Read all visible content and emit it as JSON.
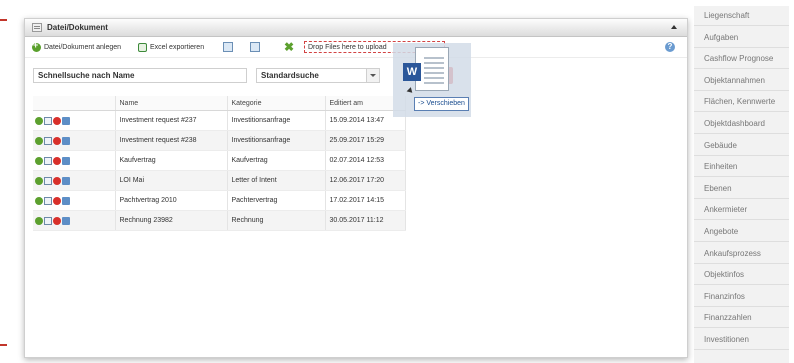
{
  "panel": {
    "title": "Datei/Dokument"
  },
  "toolbar": {
    "add_label": "Datei/Dokument anlegen",
    "export_label": "Excel exportieren",
    "dropzone_text": "Drop Files here to upload",
    "help_symbol": "?"
  },
  "search": {
    "quick_value": "Schnellsuche nach Name",
    "mode_value": "Standardsuche",
    "button_tail": "n"
  },
  "grid": {
    "columns": [
      "Name",
      "Kategorie",
      "Editiert am"
    ],
    "rows": [
      {
        "name": "Investment request #237",
        "kategorie": "Investitionsanfrage",
        "editiert": "15.09.2014 13:47"
      },
      {
        "name": "Investment request #238",
        "kategorie": "Investitionsanfrage",
        "editiert": "25.09.2017 15:29"
      },
      {
        "name": "Kaufvertrag",
        "kategorie": "Kaufvertrag",
        "editiert": "02.07.2014 12:53"
      },
      {
        "name": "LOI Mai",
        "kategorie": "Letter of Intent",
        "editiert": "12.06.2017 17:20"
      },
      {
        "name": "Pachtvertrag 2010",
        "kategorie": "Pachtervertrag",
        "editiert": "17.02.2017 14:15"
      },
      {
        "name": "Rechnung 23982",
        "kategorie": "Rechnung",
        "editiert": "30.05.2017 11:12"
      }
    ]
  },
  "drag": {
    "badge": "W",
    "tooltip": "-> Verschieben"
  },
  "sidebar": {
    "items": [
      "Liegenschaft",
      "Aufgaben",
      "Cashflow Prognose",
      "Objektannahmen",
      "Flächen, Kennwerte",
      "Objektdashboard",
      "Gebäude",
      "Einheiten",
      "Ebenen",
      "Ankermieter",
      "Angebote",
      "Ankaufsprozess",
      "Objektinfos",
      "Finanzinfos",
      "Finanzzahlen",
      "Investitionen"
    ]
  },
  "colors": {
    "accent_red": "#d9322e",
    "word_blue": "#2b579a",
    "ok_green": "#5ca02e"
  }
}
